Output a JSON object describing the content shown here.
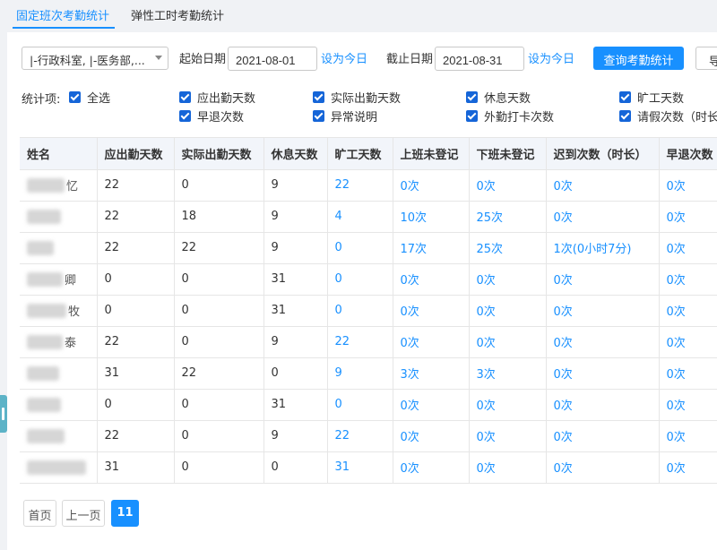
{
  "tabs": [
    "固定班次考勤统计",
    "弹性工时考勤统计"
  ],
  "filters": {
    "department": "|-行政科室, |-医务部,...",
    "start_label": "起始日期",
    "start_date": "2021-08-01",
    "set_today_1": "设为今日",
    "end_label": "截止日期",
    "end_date": "2021-08-31",
    "set_today_2": "设为今日",
    "query_button": "查询考勤统计",
    "export_button": "导"
  },
  "stats": {
    "label": "统计项:",
    "select_all": "全选",
    "items": [
      "应出勤天数",
      "实际出勤天数",
      "休息天数",
      "旷工天数",
      "早退次数",
      "异常说明",
      "外勤打卡次数",
      "请假次数（时长"
    ]
  },
  "table": {
    "headers": [
      "姓名",
      "应出勤天数",
      "实际出勤天数",
      "休息天数",
      "旷工天数",
      "上班未登记",
      "下班未登记",
      "迟到次数（时长）",
      "早退次数"
    ],
    "rows": [
      {
        "name": "忆",
        "c": [
          "22",
          "0",
          "9",
          "22",
          "0次",
          "0次",
          "0次",
          "0次"
        ]
      },
      {
        "name": "",
        "c": [
          "22",
          "18",
          "9",
          "4",
          "10次",
          "25次",
          "0次",
          "0次"
        ]
      },
      {
        "name": "",
        "c": [
          "22",
          "22",
          "9",
          "0",
          "17次",
          "25次",
          "1次(0小时7分)",
          "0次"
        ]
      },
      {
        "name": "卿",
        "c": [
          "0",
          "0",
          "31",
          "0",
          "0次",
          "0次",
          "0次",
          "0次"
        ]
      },
      {
        "name": "牧",
        "c": [
          "0",
          "0",
          "31",
          "0",
          "0次",
          "0次",
          "0次",
          "0次"
        ]
      },
      {
        "name": "泰",
        "c": [
          "22",
          "0",
          "9",
          "22",
          "0次",
          "0次",
          "0次",
          "0次"
        ]
      },
      {
        "name": "",
        "c": [
          "31",
          "22",
          "0",
          "9",
          "3次",
          "3次",
          "0次",
          "0次"
        ]
      },
      {
        "name": "",
        "c": [
          "0",
          "0",
          "31",
          "0",
          "0次",
          "0次",
          "0次",
          "0次"
        ]
      },
      {
        "name": "",
        "c": [
          "22",
          "0",
          "9",
          "22",
          "0次",
          "0次",
          "0次",
          "0次"
        ]
      },
      {
        "name": "",
        "c": [
          "31",
          "0",
          "0",
          "31",
          "0次",
          "0次",
          "0次",
          "0次"
        ]
      }
    ]
  },
  "pagination": {
    "first": "首页",
    "prev": "上一页",
    "current": "11"
  },
  "colors": {
    "accent": "#1890ff",
    "checkbox": "#1565d8",
    "header_bg": "#f2f5fa"
  }
}
